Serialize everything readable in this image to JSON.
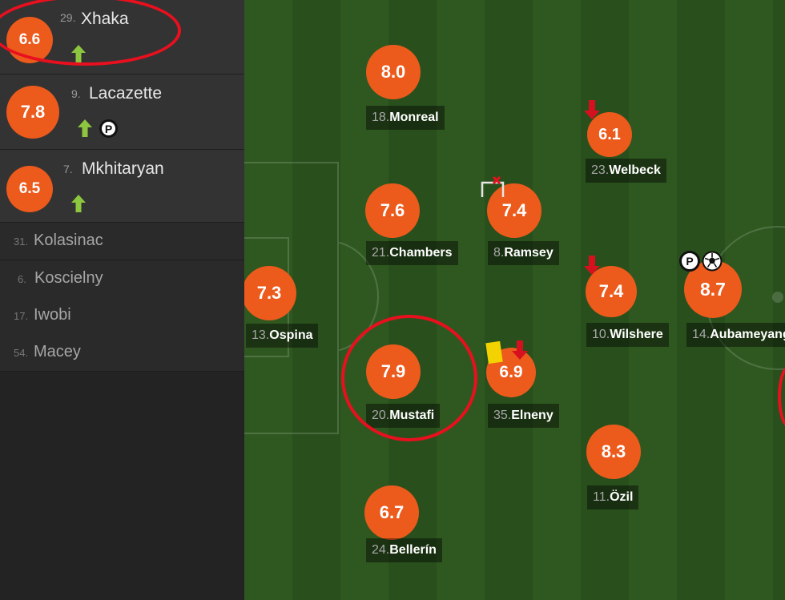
{
  "substitutes": [
    {
      "rating": "6.6",
      "number": "29.",
      "name": "Xhaka",
      "icons": [
        "sub-in-arrow"
      ]
    },
    {
      "rating": "7.8",
      "number": "9.",
      "name": "Lacazette",
      "icons": [
        "sub-in-arrow",
        "penalty-ball"
      ]
    },
    {
      "rating": "6.5",
      "number": "7.",
      "name": "Mkhitaryan",
      "icons": [
        "sub-in-arrow"
      ]
    }
  ],
  "bench": [
    {
      "number": "31.",
      "name": "Kolasinac"
    },
    {
      "number": "6.",
      "name": "Koscielny"
    },
    {
      "number": "17.",
      "name": "Iwobi"
    },
    {
      "number": "54.",
      "name": "Macey"
    }
  ],
  "pitch_players": [
    {
      "rating": "7.3",
      "number": "13.",
      "name": "Ospina",
      "icons": []
    },
    {
      "rating": "8.0",
      "number": "18.",
      "name": "Monreal",
      "icons": []
    },
    {
      "rating": "7.6",
      "number": "21.",
      "name": "Chambers",
      "icons": []
    },
    {
      "rating": "7.9",
      "number": "20.",
      "name": "Mustafi",
      "icons": []
    },
    {
      "rating": "6.7",
      "number": "24.",
      "name": "Bellerín",
      "icons": []
    },
    {
      "rating": "7.4",
      "number": "8.",
      "name": "Ramsey",
      "icons": [
        "missed-shot-goal"
      ]
    },
    {
      "rating": "6.9",
      "number": "35.",
      "name": "Elneny",
      "icons": [
        "yellow-card",
        "sub-out-arrow"
      ]
    },
    {
      "rating": "6.1",
      "number": "23.",
      "name": "Welbeck",
      "icons": [
        "sub-out-arrow"
      ]
    },
    {
      "rating": "7.4",
      "number": "10.",
      "name": "Wilshere",
      "icons": [
        "sub-out-arrow"
      ]
    },
    {
      "rating": "8.3",
      "number": "11.",
      "name": "Özil",
      "icons": []
    },
    {
      "rating": "8.7",
      "number": "14.",
      "name": "Aubameyang",
      "icons": [
        "penalty-ball",
        "goal-ball"
      ]
    }
  ],
  "highlights": [
    "Xhaka",
    "Mustafi"
  ],
  "colors": {
    "rating": "#ec5a1c",
    "sub_in": "#8dc63f",
    "sub_out": "#d6101f",
    "yellow_card": "#f2d200",
    "highlight_ring": "#e8101e",
    "pitch_dark": "#29501c",
    "pitch_light": "#2f5820"
  }
}
